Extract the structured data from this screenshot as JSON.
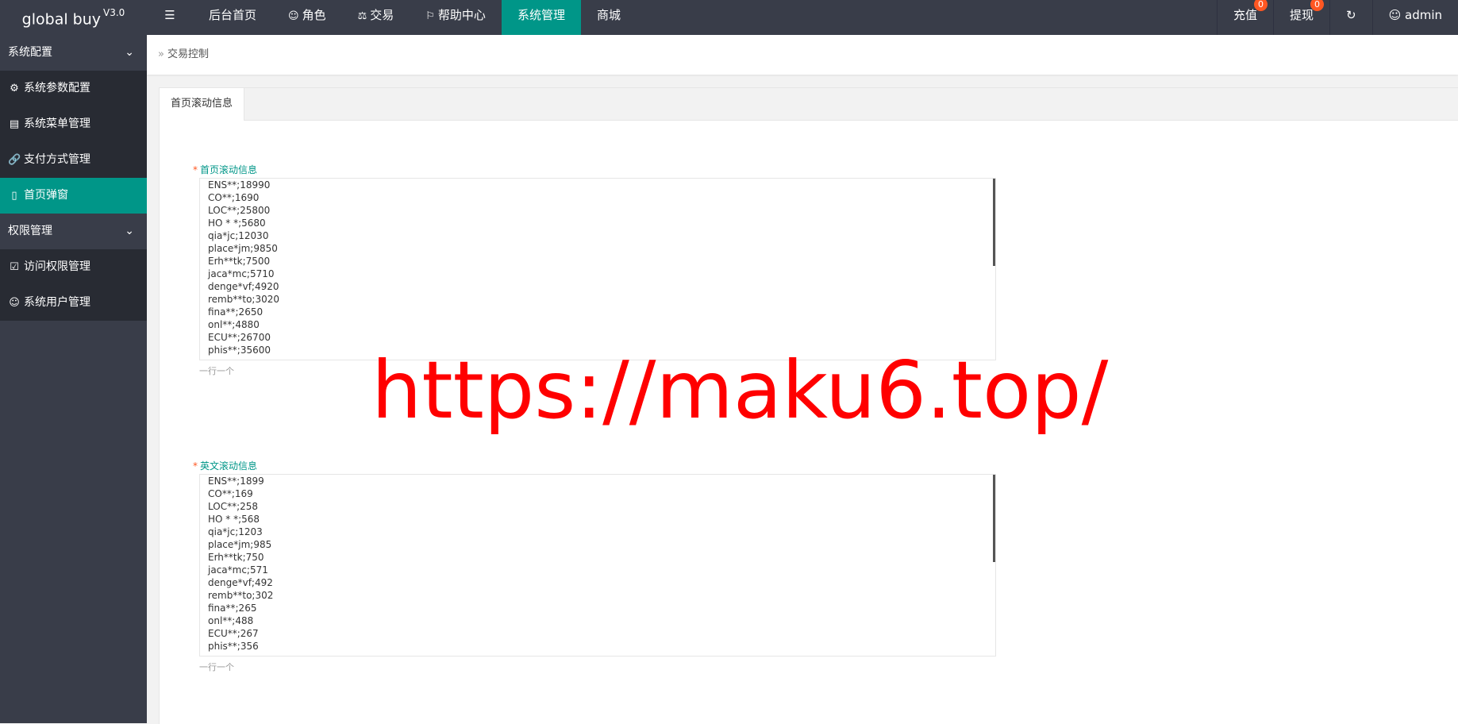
{
  "app": {
    "logo": "global buy",
    "version": "V3.0"
  },
  "topnav": {
    "toggle_icon": "menu-fold-icon",
    "items": [
      {
        "label": "后台首页",
        "icon": ""
      },
      {
        "label": "角色",
        "icon": "user-icon"
      },
      {
        "label": "交易",
        "icon": "scale-icon"
      },
      {
        "label": "帮助中心",
        "icon": "flag-icon"
      },
      {
        "label": "系统管理",
        "icon": "",
        "active": true
      },
      {
        "label": "商城",
        "icon": ""
      }
    ]
  },
  "rightnav": {
    "recharge": {
      "label": "充值",
      "badge": "0"
    },
    "withdraw": {
      "label": "提现",
      "badge": "0"
    },
    "refresh_icon": "refresh-icon",
    "user": {
      "label": "admin",
      "icon": "user-icon"
    }
  },
  "sidebar": {
    "groups": [
      {
        "label": "系统配置",
        "items": [
          {
            "label": "系统参数配置",
            "icon": "gear-icon"
          },
          {
            "label": "系统菜单管理",
            "icon": "layout-icon"
          },
          {
            "label": "支付方式管理",
            "icon": "link-icon"
          },
          {
            "label": "首页弹窗",
            "icon": "mobile-icon",
            "active": true
          }
        ]
      },
      {
        "label": "权限管理",
        "items": [
          {
            "label": "访问权限管理",
            "icon": "shield-icon"
          },
          {
            "label": "系统用户管理",
            "icon": "user-icon"
          }
        ]
      }
    ]
  },
  "breadcrumb": "交易控制",
  "tab": "首页滚动信息",
  "form": {
    "field1": {
      "label": "首页滚动信息",
      "lines": [
        "ENS**;18990",
        "CO**;1690",
        "LOC**;25800",
        "HO * *;5680",
        "qia*jc;12030",
        "place*jm;9850",
        "Erh**tk;7500",
        "jaca*mc;5710",
        "denge*vf;4920",
        "remb**to;3020",
        "fina**;2650",
        "onl**;4880",
        "ECU**;26700",
        "phis**;35600"
      ],
      "hint": "一行一个"
    },
    "field2": {
      "label": "英文滚动信息",
      "lines": [
        "ENS**;1899",
        "CO**;169",
        "LOC**;258",
        "HO * *;568",
        "qia*jc;1203",
        "place*jm;985",
        "Erh**tk;750",
        "jaca*mc;571",
        "denge*vf;492",
        "remb**to;302",
        "fina**;265",
        "onl**;488",
        "ECU**;267",
        "phis**;356"
      ],
      "hint": "一行一个"
    }
  },
  "watermark": "https://maku6.top/"
}
